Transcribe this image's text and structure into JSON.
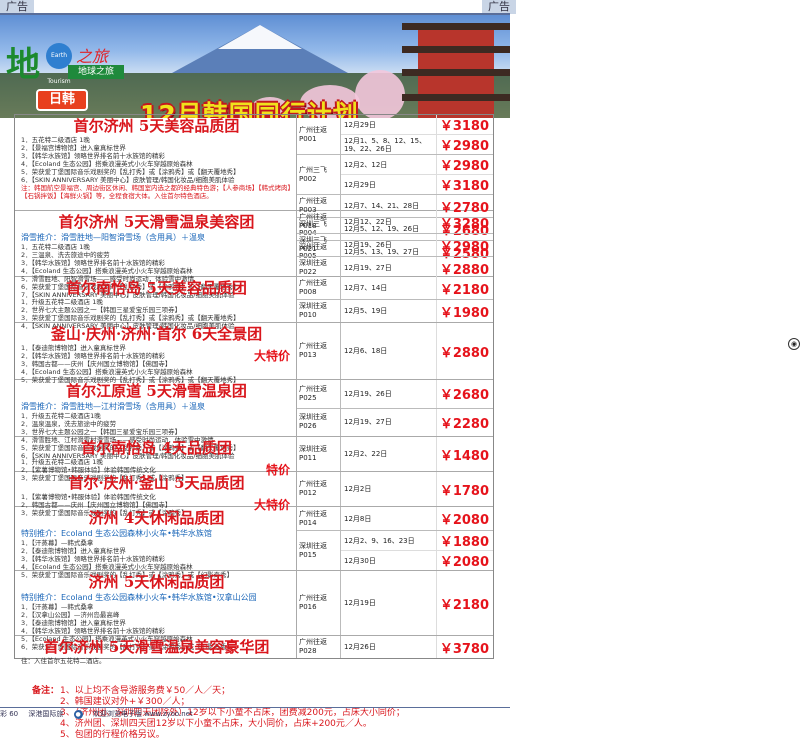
{
  "ad_label": "广告",
  "banner": {
    "logo_main": "地",
    "logo_globe": "Earth Tourism",
    "logo_suffix": "之旅",
    "logo_sub": "地球之旅",
    "region_tag": "日韩",
    "title": "12月韩国同行计划"
  },
  "tours": [
    {
      "title": "首尔济州 5天美容品质团",
      "highlight": "",
      "items": [
        "1．五花特二级酒店 1晚",
        "2．【景福宫博物馆】进入童真标世界",
        "3．【韩华水族馆】领略世界排名前十水族馆的精彩",
        "4．【Ecoland 生态公园】搭乘浪漫英式小火车穿越原始森林",
        "5．荣获爱丁堡国际音乐戏剧奖的【乱打秀】或【涂鸦秀】或【翻天覆地秀】",
        "6．【SKIN ANNIVERSARY 美丽中心】皮肤管理/韩国化妆品/细胞美肌体验"
      ],
      "note": "注：韩国航空景福宫、周边街区休闲、韩国室内选之都的经典特色游；【人参商场】【韩式烤肉】【石锅拌饭】【海鲜火锅】等，全程食宿大体。入住首尔特色酒店。",
      "departures": [
        {
          "code": "广州往返 P001",
          "dates": [
            {
              "d": "12月29日",
              "p": "￥3180"
            },
            {
              "d": "12月1、5、8、12、15、19、22、26日",
              "p": "￥2980"
            }
          ]
        },
        {
          "code": "广州三飞 P002",
          "dates": [
            {
              "d": "12月2、12日",
              "p": "￥2980"
            },
            {
              "d": "12月29日",
              "p": "￥3180"
            }
          ]
        },
        {
          "code": "广州往返 P003",
          "dates": [
            {
              "d": "12月7、14、21、28日",
              "p": "￥2780"
            }
          ]
        },
        {
          "code": "深圳三飞 P004",
          "dates": [
            {
              "d": "12月5、12、19、26日",
              "p": "￥2680"
            }
          ]
        },
        {
          "code": "深圳往返 P005",
          "dates": [
            {
              "d": "12月5、13、19、27日",
              "p": "￥2580"
            }
          ]
        }
      ]
    },
    {
      "title": "首尔济州 5天滑雪温泉美容团",
      "highlight": "滑雪推介：滑雪胜地—阳智滑雪场（含用具）＋温泉",
      "items": [
        "1．五花特二级酒店 1晚",
        "2．三温泉、洗去旅途中的疲劳",
        "3．【韩华水族馆】领略世界排名前十水族馆的精彩",
        "4．【Ecoland 生态公园】搭乘浪漫英式小火车穿越原始森林",
        "5．滑雪胜地、阳智滑雪场——感受时尚运动，体验雪中激情",
        "6．荣获爱丁堡国际音乐戏剧奖的【乱打秀】或【涂鸦秀】或【翻天覆地秀】",
        "7．【SKIN ANNIVERSARY 美丽中心】皮肤管理/韩国化妆品/细胞美肌体验"
      ],
      "note": "",
      "departures": [
        {
          "code": "广州往返 P018",
          "dates": [
            {
              "d": "12月12、22日",
              "p": "￥3280"
            }
          ]
        },
        {
          "code": "深圳三飞 P021",
          "dates": [
            {
              "d": "12月19、26日",
              "p": "￥2980"
            }
          ]
        },
        {
          "code": "深圳往返 P022",
          "dates": [
            {
              "d": "12月19、27日",
              "p": "￥2880"
            }
          ]
        }
      ]
    },
    {
      "title": "首尔南怡岛 5天美容品质团",
      "highlight": "",
      "items": [
        "1．升级五花特二级酒店 1晚",
        "2．世界七大主题公园之一【韩国三星爱宝乐园三项券】",
        "3．荣获爱丁堡国际音乐戏剧奖的【乱打秀】或【涂鸦秀】或【翻天覆地秀】",
        "4．【SKIN ANNIVERSARY 美丽中心】皮肤管理/韩国化妆品/细胞美肌体验"
      ],
      "note": "",
      "departures": [
        {
          "code": "广州往返 P008",
          "dates": [
            {
              "d": "12月7、14日",
              "p": "￥2180"
            }
          ]
        },
        {
          "code": "深圳往返 P010",
          "dates": [
            {
              "d": "12月5、19日",
              "p": "￥1980"
            }
          ]
        }
      ]
    },
    {
      "title": "釜山·庆州·济州·首尔 6天全景团",
      "highlight": "",
      "special": "大特价",
      "items": [
        "1．【泰迪熊博物馆】进入童真标世界",
        "2．【韩华水族馆】领略世界排名前十水族馆的精彩",
        "3．韩国古都——庆州【庆州国立博物馆】【佛国寺】",
        "4．【Ecoland 生态公园】搭乘浪漫英式小火车穿越原始森林",
        "5．荣获爱丁堡国际音乐戏剧奖的【乱打秀】或【涂鸦秀】或【翻天覆地秀】"
      ],
      "note": "",
      "departures": [
        {
          "code": "广州往返 P013",
          "dates": [
            {
              "d": "12月6、18日",
              "p": "￥2880"
            }
          ]
        }
      ]
    },
    {
      "title": "首尔江原道 5天滑雪温泉团",
      "highlight": "滑雪推介：滑雪胜地—江村滑雪场（含用具）＋温泉",
      "items": [
        "1．升级五花特二级酒店1晚",
        "2．温泉温泉，洗去旅途中的疲劳",
        "3．世界七大主题公园之一【韩国三星爱宝乐园三项券】",
        "4．滑雪胜地、江村滑雪村滑雪场——感受时尚运动，体验雪中激情",
        "5．荣获爱丁堡国际音乐戏剧奖的【乱打秀】或【涂鸦秀】或【翻天覆地秀】",
        "6．【SKIN ANNIVERSARY 美丽中心】皮肤管理/韩国化妆品/细胞美肌体验"
      ],
      "note": "",
      "departures": [
        {
          "code": "广州往返 P025",
          "dates": [
            {
              "d": "12月19、26日",
              "p": "￥2680"
            }
          ]
        },
        {
          "code": "深圳往返 P026",
          "dates": [
            {
              "d": "12月19、27日",
              "p": "￥2280"
            }
          ]
        }
      ]
    },
    {
      "title": "首尔南怡岛 4天品质团",
      "highlight": "",
      "special": "特价",
      "items": [
        "1．升级五花特二级酒店 1晚",
        "2．【紫薯博物馆•韩服体验】体验韩国传统文化",
        "3．荣获爱丁堡国际音乐戏剧奖的【乱打秀】或【涂鸦秀】"
      ],
      "note": "",
      "departures": [
        {
          "code": "深圳往返 P011",
          "dates": [
            {
              "d": "12月2、22日",
              "p": "￥1480"
            }
          ]
        }
      ]
    },
    {
      "title": "首尔·庆州·釜山 5天品质团",
      "highlight": "",
      "special": "大特价",
      "items": [
        "1．【紫薯博物馆•韩服体验】体验韩国传统文化",
        "2．韩国古都——庆州【庆州国立博物馆】【佛国寺】",
        "3．荣获爱丁堡国际音乐戏剧奖的【乱打秀】或【涂鸦秀】"
      ],
      "note": "",
      "departures": [
        {
          "code": "广州往返 P012",
          "dates": [
            {
              "d": "12月2日",
              "p": "￥1780"
            }
          ]
        }
      ]
    },
    {
      "title": "济州 4天休闲品质团",
      "highlight": "特别推介：Ecoland 生态公园森林小火车•韩华水族馆",
      "items": [
        "1．【汗蒸幕】—韩式桑拿",
        "2．【泰迪熊博物馆】进入童真标世界",
        "3．【韩华水族馆】领略世界排名前十水族馆的精彩",
        "4．【Ecoland 生态公园】搭乘浪漫英式小火车穿越原始森林",
        "5．荣获爱丁堡国际音乐戏剧奖的【乱打秀】或【涂鸦秀】或【幻影奇秀】"
      ],
      "note": "",
      "departures": [
        {
          "code": "广州往返 P014",
          "dates": [
            {
              "d": "12月8日",
              "p": "￥2080"
            }
          ]
        },
        {
          "code": "深圳往返 P015",
          "dates": [
            {
              "d": "12月2、9、16、23日",
              "p": "￥1880"
            },
            {
              "d": "12月30日",
              "p": "￥2080"
            }
          ]
        }
      ]
    },
    {
      "title": "济州 5天休闲品质团",
      "highlight": "特别推介：Ecoland 生态公园森林小火车•韩华水族馆•汉拿山公园",
      "items": [
        "1．【汗蒸幕】—韩式桑拿",
        "2．【汉拿山公园】—济州岛最高峰",
        "3．【泰迪熊博物馆】进入童真标世界",
        "4．【韩华水族馆】领略世界排名前十水族馆的精彩",
        "5．【Ecoland 生态公园】搭乘浪漫英式小火车穿越原始森林",
        "6．荣获爱丁堡国际音乐戏剧奖的【乱打秀】或【涂鸦秀】或【幻影奇秀】"
      ],
      "note": "",
      "departures": [
        {
          "code": "广州往返 P016",
          "dates": [
            {
              "d": "12月19日",
              "p": "￥2180"
            }
          ]
        }
      ]
    },
    {
      "title": "首尔济州 5天滑雪温泉美容豪华团",
      "highlight": "",
      "items": [
        "住：入住首尔五花特二酒店。"
      ],
      "note": "",
      "departures": [
        {
          "code": "广州往返 P028",
          "dates": [
            {
              "d": "12月26日",
              "p": "￥3780"
            }
          ]
        }
      ]
    }
  ],
  "notes": {
    "label": "备注：",
    "lines": [
      "1、以上均不含导游服务费￥50／人／天；",
      "2、韩国建议对外+￥300／人；",
      "3、（济州团、深圳四天团除外）12岁以下小童不占床，团费减200元，占床大小同价；",
      "4、济州团、深圳四天团12岁以下小童不占床，大小同价，占床+200元／人。",
      "5、包团的行程价格另议。"
    ]
  },
  "footer": {
    "page": "彩 60",
    "mag": "深港国际旅",
    "site": "欢迎浏览电子版 www.zyoo.net"
  }
}
